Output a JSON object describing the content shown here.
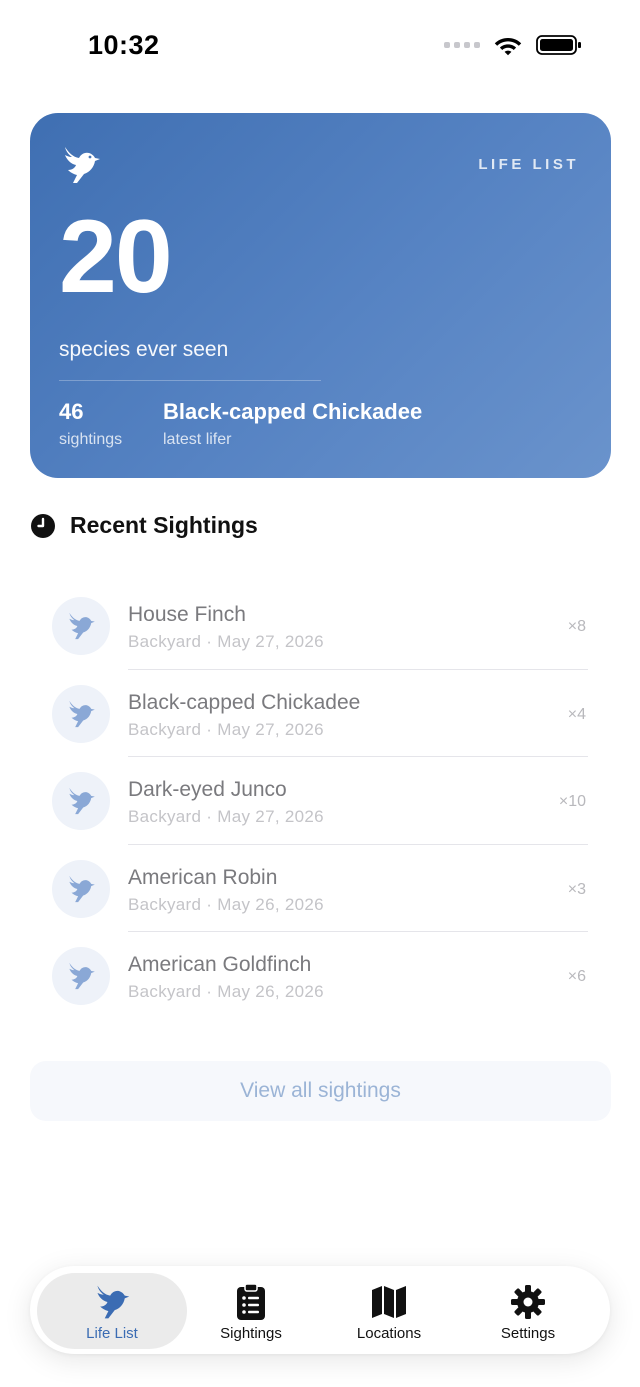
{
  "status_bar": {
    "time": "10:32"
  },
  "hero": {
    "tag": "LIFE LIST",
    "count": "20",
    "caption": "species ever seen",
    "sightings_value": "46",
    "sightings_label": "sightings",
    "lifer_value": "Black-capped Chickadee",
    "lifer_label": "latest lifer",
    "icon": "bird-icon"
  },
  "recent": {
    "title": "Recent Sightings",
    "icon": "clock-icon",
    "items": [
      {
        "name": "House Finch",
        "meta": "Backyard · May 27, 2026",
        "count": "×8"
      },
      {
        "name": "Black-capped Chickadee",
        "meta": "Backyard · May 27, 2026",
        "count": "×4"
      },
      {
        "name": "Dark-eyed Junco",
        "meta": "Backyard · May 27, 2026",
        "count": "×10"
      },
      {
        "name": "American Robin",
        "meta": "Backyard · May 26, 2026",
        "count": "×3"
      },
      {
        "name": "American Goldfinch",
        "meta": "Backyard · May 26, 2026",
        "count": "×6"
      }
    ]
  },
  "view_all_label": "View all sightings",
  "tabs": [
    {
      "label": "Life List",
      "icon": "bird-icon",
      "active": true
    },
    {
      "label": "Sightings",
      "icon": "clipboard-icon",
      "active": false
    },
    {
      "label": "Locations",
      "icon": "map-icon",
      "active": false
    },
    {
      "label": "Settings",
      "icon": "gear-icon",
      "active": false
    }
  ],
  "colors": {
    "accent": "#3b6cb3",
    "hero_gradient_start": "#3f6fb2",
    "hero_gradient_end": "#6a93cc"
  }
}
